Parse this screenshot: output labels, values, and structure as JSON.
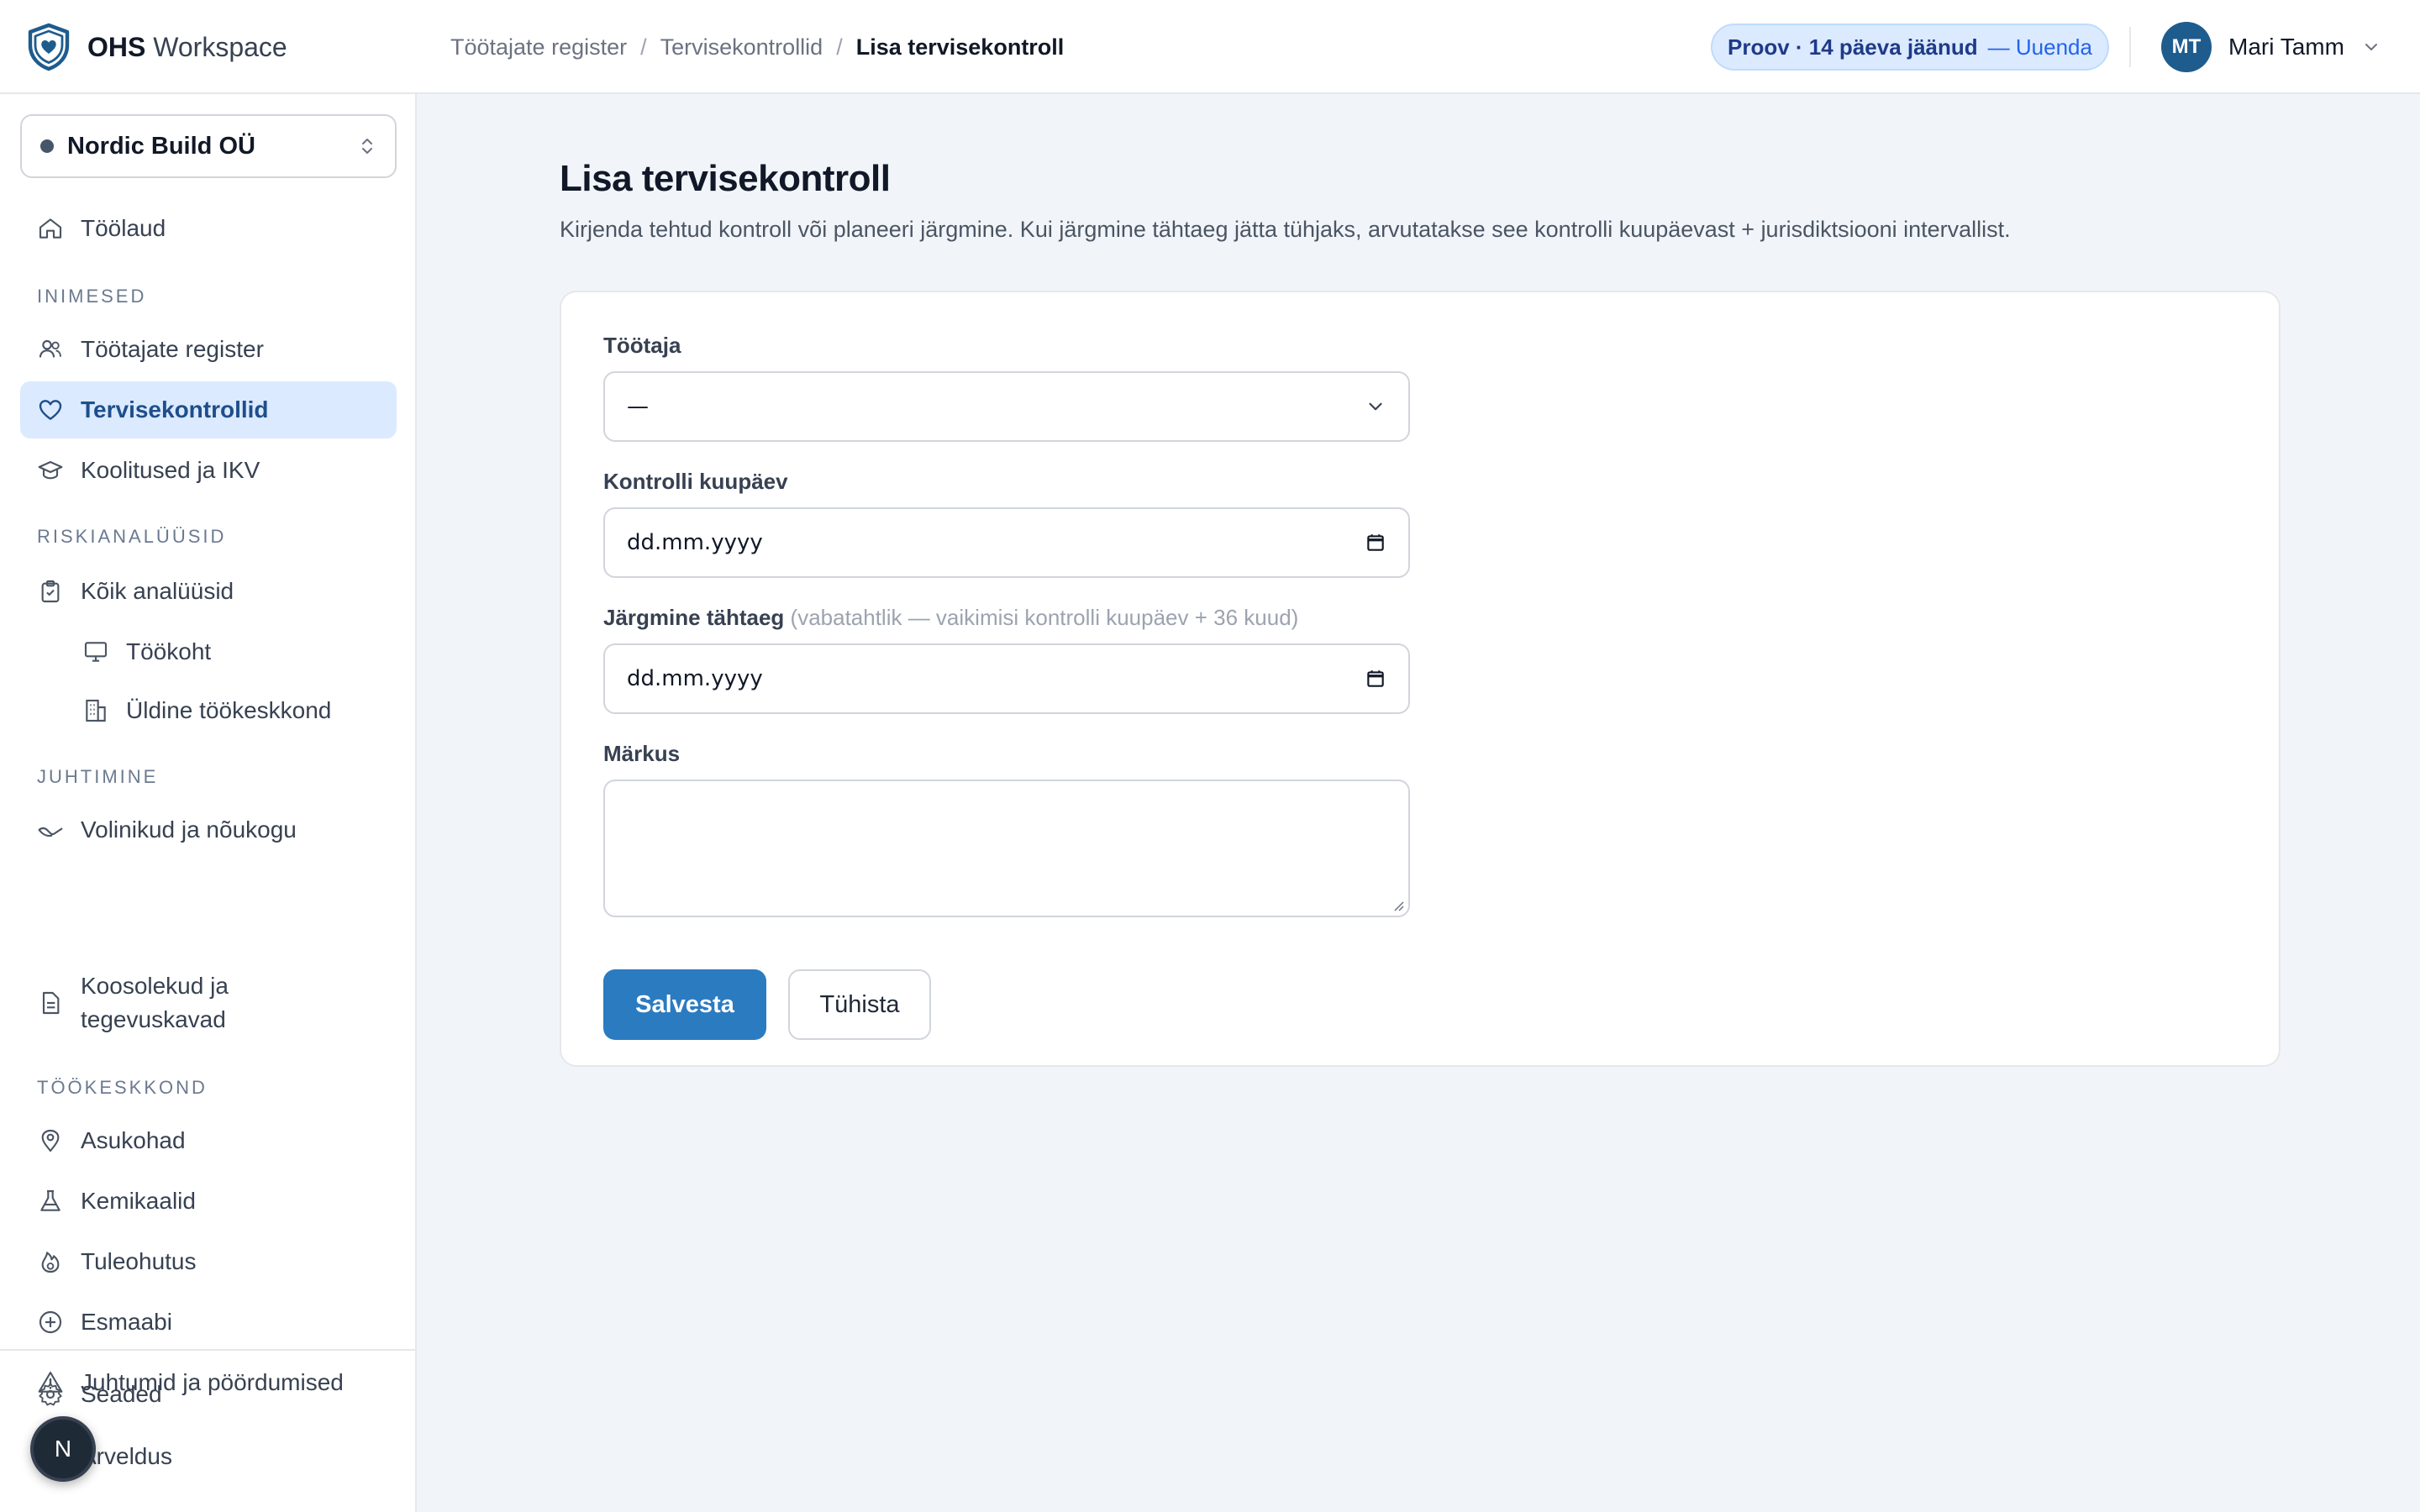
{
  "app": {
    "brand_bold": "OHS",
    "brand_rest": "Workspace"
  },
  "breadcrumb": [
    "Töötajate register",
    "Tervisekontrollid",
    "Lisa tervisekontroll"
  ],
  "trial": {
    "text": "Proov · 14 päeva jäänud",
    "renew": "— Uuenda"
  },
  "user": {
    "initials": "MT",
    "name": "Mari Tamm"
  },
  "org": {
    "name": "Nordic Build OÜ"
  },
  "sidebar": {
    "dashboard": "Töölaud",
    "sections": {
      "people": "INIMESED",
      "risk": "RISKIANALÜÜSID",
      "management": "JUHTIMINE",
      "environment": "TÖÖKESKKOND"
    },
    "items": {
      "employees": "Töötajate register",
      "health_checks": "Tervisekontrollid",
      "trainings": "Koolitused ja IKV",
      "all_analyses": "Kõik analüüsid",
      "workplace": "Töökoht",
      "general_env": "Üldine töökeskkond",
      "representatives": "Volinikud ja nõukogu",
      "meetings": "Koosolekud ja tegevuskavad",
      "locations": "Asukohad",
      "chemicals": "Kemikaalid",
      "fire_safety": "Tuleohutus",
      "first_aid": "Esmaabi",
      "incidents": "Juhtumid ja pöördumised",
      "settings": "Seaded",
      "billing": "Arveldus"
    },
    "fab": "N"
  },
  "page": {
    "title": "Lisa tervisekontroll",
    "description": "Kirjenda tehtud kontroll või planeeri järgmine. Kui järgmine tähtaeg jätta tühjaks, arvutatakse see kontrolli kuupäevast + jurisdiktsiooni intervallist."
  },
  "form": {
    "employee_label": "Töötaja",
    "employee_value": "—",
    "check_date_label": "Kontrolli kuupäev",
    "check_date_value": "dd.mm.yyyy",
    "next_due_label": "Järgmine tähtaeg",
    "next_due_hint": "(vabatahtlik — vaikimisi kontrolli kuupäev + 36 kuud)",
    "next_due_value": "dd.mm.yyyy",
    "note_label": "Märkus",
    "note_value": "",
    "save": "Salvesta",
    "cancel": "Tühista"
  }
}
